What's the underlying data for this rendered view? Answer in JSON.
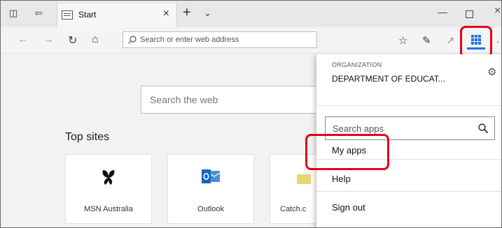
{
  "tab": {
    "title": "Start"
  },
  "address_bar": {
    "placeholder": "Search or enter web address"
  },
  "start_page": {
    "search_placeholder": "Search the web",
    "top_sites_title": "Top sites",
    "tiles": [
      {
        "label": "MSN Australia",
        "icon": "butterfly-icon"
      },
      {
        "label": "Outlook",
        "icon": "outlook-icon"
      },
      {
        "label": "Catch.c",
        "icon": "catch-icon"
      }
    ]
  },
  "apps_panel": {
    "org_label": "ORGANIZATION",
    "org_name": "DEPARTMENT OF EDUCAT...",
    "search_placeholder": "Search apps",
    "items": [
      "My apps",
      "Help",
      "Sign out"
    ]
  },
  "colors": {
    "highlight": "#e3001b",
    "accent": "#1a73e8"
  }
}
